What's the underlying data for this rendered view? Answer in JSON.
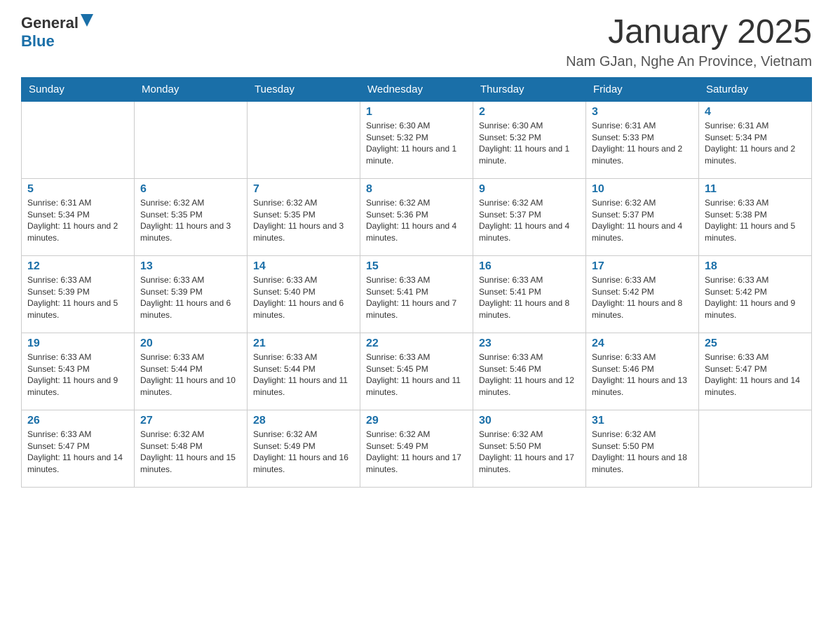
{
  "header": {
    "logo": {
      "general": "General",
      "blue": "Blue"
    },
    "title": "January 2025",
    "subtitle": "Nam GJan, Nghe An Province, Vietnam"
  },
  "weekdays": [
    "Sunday",
    "Monday",
    "Tuesday",
    "Wednesday",
    "Thursday",
    "Friday",
    "Saturday"
  ],
  "weeks": [
    [
      {
        "day": "",
        "info": ""
      },
      {
        "day": "",
        "info": ""
      },
      {
        "day": "",
        "info": ""
      },
      {
        "day": "1",
        "info": "Sunrise: 6:30 AM\nSunset: 5:32 PM\nDaylight: 11 hours and 1 minute."
      },
      {
        "day": "2",
        "info": "Sunrise: 6:30 AM\nSunset: 5:32 PM\nDaylight: 11 hours and 1 minute."
      },
      {
        "day": "3",
        "info": "Sunrise: 6:31 AM\nSunset: 5:33 PM\nDaylight: 11 hours and 2 minutes."
      },
      {
        "day": "4",
        "info": "Sunrise: 6:31 AM\nSunset: 5:34 PM\nDaylight: 11 hours and 2 minutes."
      }
    ],
    [
      {
        "day": "5",
        "info": "Sunrise: 6:31 AM\nSunset: 5:34 PM\nDaylight: 11 hours and 2 minutes."
      },
      {
        "day": "6",
        "info": "Sunrise: 6:32 AM\nSunset: 5:35 PM\nDaylight: 11 hours and 3 minutes."
      },
      {
        "day": "7",
        "info": "Sunrise: 6:32 AM\nSunset: 5:35 PM\nDaylight: 11 hours and 3 minutes."
      },
      {
        "day": "8",
        "info": "Sunrise: 6:32 AM\nSunset: 5:36 PM\nDaylight: 11 hours and 4 minutes."
      },
      {
        "day": "9",
        "info": "Sunrise: 6:32 AM\nSunset: 5:37 PM\nDaylight: 11 hours and 4 minutes."
      },
      {
        "day": "10",
        "info": "Sunrise: 6:32 AM\nSunset: 5:37 PM\nDaylight: 11 hours and 4 minutes."
      },
      {
        "day": "11",
        "info": "Sunrise: 6:33 AM\nSunset: 5:38 PM\nDaylight: 11 hours and 5 minutes."
      }
    ],
    [
      {
        "day": "12",
        "info": "Sunrise: 6:33 AM\nSunset: 5:39 PM\nDaylight: 11 hours and 5 minutes."
      },
      {
        "day": "13",
        "info": "Sunrise: 6:33 AM\nSunset: 5:39 PM\nDaylight: 11 hours and 6 minutes."
      },
      {
        "day": "14",
        "info": "Sunrise: 6:33 AM\nSunset: 5:40 PM\nDaylight: 11 hours and 6 minutes."
      },
      {
        "day": "15",
        "info": "Sunrise: 6:33 AM\nSunset: 5:41 PM\nDaylight: 11 hours and 7 minutes."
      },
      {
        "day": "16",
        "info": "Sunrise: 6:33 AM\nSunset: 5:41 PM\nDaylight: 11 hours and 8 minutes."
      },
      {
        "day": "17",
        "info": "Sunrise: 6:33 AM\nSunset: 5:42 PM\nDaylight: 11 hours and 8 minutes."
      },
      {
        "day": "18",
        "info": "Sunrise: 6:33 AM\nSunset: 5:42 PM\nDaylight: 11 hours and 9 minutes."
      }
    ],
    [
      {
        "day": "19",
        "info": "Sunrise: 6:33 AM\nSunset: 5:43 PM\nDaylight: 11 hours and 9 minutes."
      },
      {
        "day": "20",
        "info": "Sunrise: 6:33 AM\nSunset: 5:44 PM\nDaylight: 11 hours and 10 minutes."
      },
      {
        "day": "21",
        "info": "Sunrise: 6:33 AM\nSunset: 5:44 PM\nDaylight: 11 hours and 11 minutes."
      },
      {
        "day": "22",
        "info": "Sunrise: 6:33 AM\nSunset: 5:45 PM\nDaylight: 11 hours and 11 minutes."
      },
      {
        "day": "23",
        "info": "Sunrise: 6:33 AM\nSunset: 5:46 PM\nDaylight: 11 hours and 12 minutes."
      },
      {
        "day": "24",
        "info": "Sunrise: 6:33 AM\nSunset: 5:46 PM\nDaylight: 11 hours and 13 minutes."
      },
      {
        "day": "25",
        "info": "Sunrise: 6:33 AM\nSunset: 5:47 PM\nDaylight: 11 hours and 14 minutes."
      }
    ],
    [
      {
        "day": "26",
        "info": "Sunrise: 6:33 AM\nSunset: 5:47 PM\nDaylight: 11 hours and 14 minutes."
      },
      {
        "day": "27",
        "info": "Sunrise: 6:32 AM\nSunset: 5:48 PM\nDaylight: 11 hours and 15 minutes."
      },
      {
        "day": "28",
        "info": "Sunrise: 6:32 AM\nSunset: 5:49 PM\nDaylight: 11 hours and 16 minutes."
      },
      {
        "day": "29",
        "info": "Sunrise: 6:32 AM\nSunset: 5:49 PM\nDaylight: 11 hours and 17 minutes."
      },
      {
        "day": "30",
        "info": "Sunrise: 6:32 AM\nSunset: 5:50 PM\nDaylight: 11 hours and 17 minutes."
      },
      {
        "day": "31",
        "info": "Sunrise: 6:32 AM\nSunset: 5:50 PM\nDaylight: 11 hours and 18 minutes."
      },
      {
        "day": "",
        "info": ""
      }
    ]
  ]
}
